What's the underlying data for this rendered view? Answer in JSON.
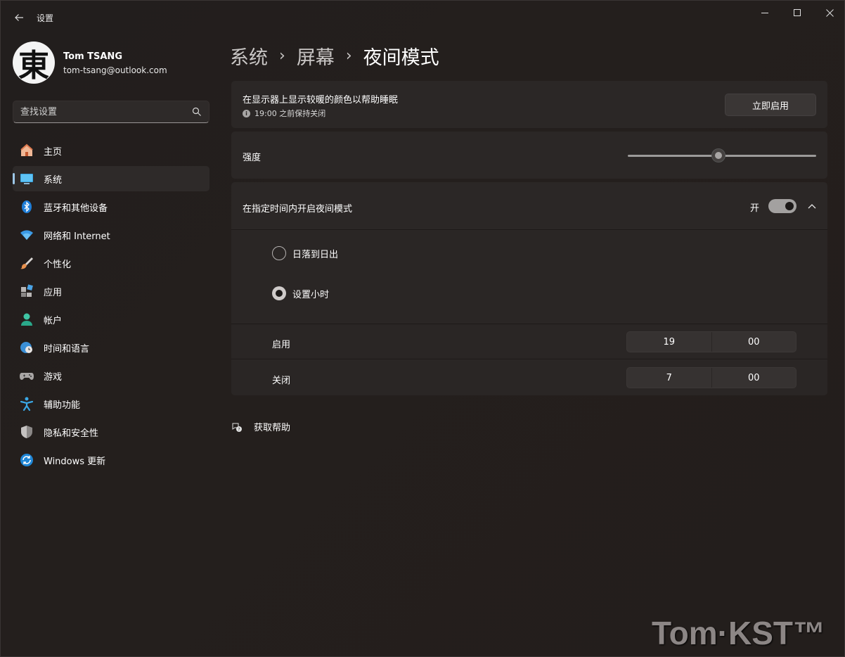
{
  "window": {
    "app_title": "设置",
    "controls": {
      "minimize": "minimize-icon",
      "maximize": "maximize-icon",
      "close": "close-icon"
    }
  },
  "profile": {
    "avatar_glyph": "東",
    "name": "Tom TSANG",
    "email": "tom-tsang@outlook.com"
  },
  "search": {
    "placeholder": "查找设置",
    "value": ""
  },
  "sidebar": {
    "items": [
      {
        "label": "主页",
        "icon": "home-icon",
        "active": false
      },
      {
        "label": "系统",
        "icon": "monitor-icon",
        "active": true
      },
      {
        "label": "蓝牙和其他设备",
        "icon": "bluetooth-icon",
        "active": false
      },
      {
        "label": "网络和 Internet",
        "icon": "wifi-icon",
        "active": false
      },
      {
        "label": "个性化",
        "icon": "brush-icon",
        "active": false
      },
      {
        "label": "应用",
        "icon": "apps-icon",
        "active": false
      },
      {
        "label": "帐户",
        "icon": "account-icon",
        "active": false
      },
      {
        "label": "时间和语言",
        "icon": "globe-clock-icon",
        "active": false
      },
      {
        "label": "游戏",
        "icon": "gamepad-icon",
        "active": false
      },
      {
        "label": "辅助功能",
        "icon": "accessibility-icon",
        "active": false
      },
      {
        "label": "隐私和安全性",
        "icon": "shield-icon",
        "active": false
      },
      {
        "label": "Windows 更新",
        "icon": "update-icon",
        "active": false
      }
    ]
  },
  "breadcrumb": {
    "parts": [
      "系统",
      "屏幕"
    ],
    "current": "夜间模式",
    "separator": "›"
  },
  "night_light": {
    "title": "在显示器上显示较暖的颜色以帮助睡眠",
    "status": "19:00 之前保持关闭",
    "enable_button": "立即启用"
  },
  "strength": {
    "label": "强度",
    "value_fraction": 0.48
  },
  "schedule": {
    "label": "在指定时间内开启夜间模式",
    "toggle_label": "开",
    "toggle_on": true,
    "options": [
      {
        "label": "日落到日出",
        "checked": false
      },
      {
        "label": "设置小时",
        "checked": true
      }
    ],
    "on_time": {
      "label": "启用",
      "hour": "19",
      "minute": "00"
    },
    "off_time": {
      "label": "关闭",
      "hour": "7",
      "minute": "00"
    }
  },
  "help": {
    "label": "获取帮助"
  },
  "watermark": "Tom·KST™",
  "colors": {
    "accent": "#9cc6e6",
    "background": "#211d1c",
    "card": "#2b2726"
  }
}
